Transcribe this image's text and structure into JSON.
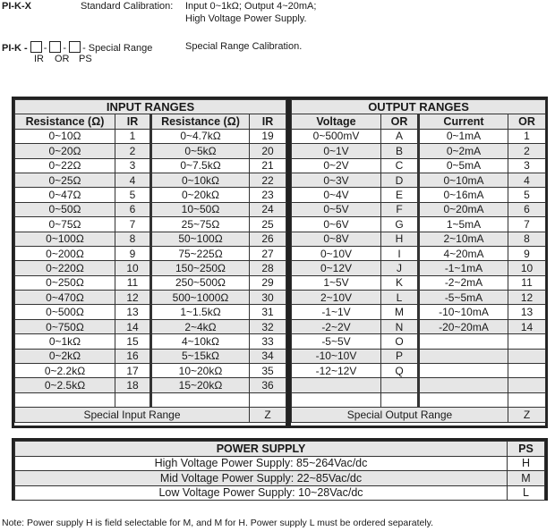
{
  "header": {
    "standard_model": "PI-K-X",
    "standard_label": "Standard Calibration:",
    "standard_desc_line1": "Input 0~1kΩ; Output 4~20mA;",
    "standard_desc_line2": "High Voltage Power Supply.",
    "special_prefix": "PI-K -",
    "special_sep": "-",
    "special_suffix": "- Special Range",
    "special_desc": "Special Range Calibration.",
    "code_labels": [
      "IR",
      "OR",
      "PS"
    ]
  },
  "input_ranges": {
    "title": "INPUT RANGES",
    "columns": [
      "Resistance (Ω)",
      "IR",
      "Resistance (Ω)",
      "IR"
    ],
    "rows": [
      [
        "0~10Ω",
        "1",
        "0~4.7kΩ",
        "19"
      ],
      [
        "0~20Ω",
        "2",
        "0~5kΩ",
        "20"
      ],
      [
        "0~22Ω",
        "3",
        "0~7.5kΩ",
        "21"
      ],
      [
        "0~25Ω",
        "4",
        "0~10kΩ",
        "22"
      ],
      [
        "0~47Ω",
        "5",
        "0~20kΩ",
        "23"
      ],
      [
        "0~50Ω",
        "6",
        "10~50Ω",
        "24"
      ],
      [
        "0~75Ω",
        "7",
        "25~75Ω",
        "25"
      ],
      [
        "0~100Ω",
        "8",
        "50~100Ω",
        "26"
      ],
      [
        "0~200Ω",
        "9",
        "75~225Ω",
        "27"
      ],
      [
        "0~220Ω",
        "10",
        "150~250Ω",
        "28"
      ],
      [
        "0~250Ω",
        "11",
        "250~500Ω",
        "29"
      ],
      [
        "0~470Ω",
        "12",
        "500~1000Ω",
        "30"
      ],
      [
        "0~500Ω",
        "13",
        "1~1.5kΩ",
        "31"
      ],
      [
        "0~750Ω",
        "14",
        "2~4kΩ",
        "32"
      ],
      [
        "0~1kΩ",
        "15",
        "4~10kΩ",
        "33"
      ],
      [
        "0~2kΩ",
        "16",
        "5~15kΩ",
        "34"
      ],
      [
        "0~2.2kΩ",
        "17",
        "10~20kΩ",
        "35"
      ],
      [
        "0~2.5kΩ",
        "18",
        "15~20kΩ",
        "36"
      ],
      [
        "",
        "",
        "",
        ""
      ]
    ],
    "special_label": "Special Input Range",
    "special_code": "Z"
  },
  "output_ranges": {
    "title": "OUTPUT RANGES",
    "columns": [
      "Voltage",
      "OR",
      "Current",
      "OR"
    ],
    "rows": [
      [
        "0~500mV",
        "A",
        "0~1mA",
        "1"
      ],
      [
        "0~1V",
        "B",
        "0~2mA",
        "2"
      ],
      [
        "0~2V",
        "C",
        "0~5mA",
        "3"
      ],
      [
        "0~3V",
        "D",
        "0~10mA",
        "4"
      ],
      [
        "0~4V",
        "E",
        "0~16mA",
        "5"
      ],
      [
        "0~5V",
        "F",
        "0~20mA",
        "6"
      ],
      [
        "0~6V",
        "G",
        "1~5mA",
        "7"
      ],
      [
        "0~8V",
        "H",
        "2~10mA",
        "8"
      ],
      [
        "0~10V",
        "I",
        "4~20mA",
        "9"
      ],
      [
        "0~12V",
        "J",
        "-1~1mA",
        "10"
      ],
      [
        "1~5V",
        "K",
        "-2~2mA",
        "11"
      ],
      [
        "2~10V",
        "L",
        "-5~5mA",
        "12"
      ],
      [
        "-1~1V",
        "M",
        "-10~10mA",
        "13"
      ],
      [
        "-2~2V",
        "N",
        "-20~20mA",
        "14"
      ],
      [
        "-5~5V",
        "O",
        "",
        ""
      ],
      [
        "-10~10V",
        "P",
        "",
        ""
      ],
      [
        "-12~12V",
        "Q",
        "",
        ""
      ],
      [
        "",
        "",
        "",
        ""
      ],
      [
        "",
        "",
        "",
        ""
      ]
    ],
    "special_label": "Special Output Range",
    "special_code": "Z"
  },
  "power_supply": {
    "title": "POWER SUPPLY",
    "code_header": "PS",
    "rows": [
      {
        "label": "High Voltage Power Supply: 85~264Vac/dc",
        "code": "H"
      },
      {
        "label": "Mid Voltage Power Supply: 22~85Vac/dc",
        "code": "M"
      },
      {
        "label": "Low Voltage Power Supply: 10~28Vac/dc",
        "code": "L"
      }
    ]
  },
  "note": "Note:  Power supply H is field selectable for M, and M for H. Power supply L must be ordered separately."
}
